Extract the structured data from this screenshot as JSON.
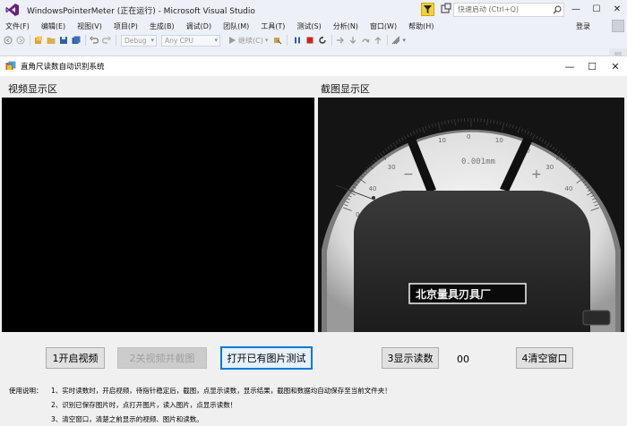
{
  "vs": {
    "title": "WindowsPointerMeter (正在运行) - Microsoft Visual Studio",
    "quick_launch_placeholder": "快速启动 (Ctrl+Q)",
    "menu": [
      "文件(F)",
      "编辑(E)",
      "视图(V)",
      "项目(P)",
      "生成(B)",
      "调试(D)",
      "团队(M)",
      "工具(T)",
      "测试(S)",
      "分析(N)",
      "窗口(W)",
      "帮助(H)"
    ],
    "login": "登录",
    "toolbar": {
      "config": "Debug",
      "platform": "Any CPU",
      "continue": "继续(C)"
    }
  },
  "app": {
    "title": "直角尺读数自动识别系统",
    "labels": {
      "video": "视频显示区",
      "crop": "截图显示区"
    },
    "gauge": {
      "brand_text": "北京量具刃具厂",
      "scale_text": "0.001mm"
    },
    "buttons": {
      "start_video": "1开启视频",
      "stop_capture": "2关视频并截图",
      "open_image": "打开已有图片测试",
      "show_reading": "3显示读数",
      "clear": "4清空窗口"
    },
    "reading_value": "00",
    "instructions": {
      "heading": "使用说明：",
      "lines": [
        "1、实时读数时，开启视频，待指针稳定后，截图，点显示读数，显示结果，截图和数据均自动保存至当前文件夹！",
        "2、识别已保存图片时，点打开图片，读入图片，点显示读数！",
        "3、清空窗口，清楚之前显示的视频、图片和读数。"
      ]
    }
  }
}
